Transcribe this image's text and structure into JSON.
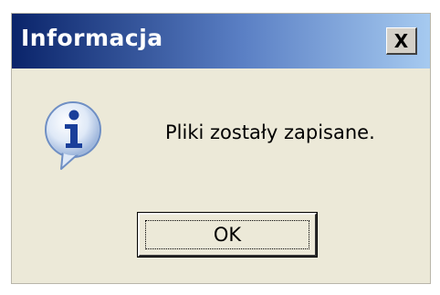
{
  "window": {
    "title": "Informacja",
    "close_symbol": "X"
  },
  "dialog": {
    "icon": "info-icon",
    "message": "Pliki zostały zapisane."
  },
  "buttons": {
    "ok_label": "OK"
  },
  "colors": {
    "titlebar_start": "#0a246a",
    "titlebar_end": "#a6caf0",
    "dialog_background": "#ece9d8"
  }
}
